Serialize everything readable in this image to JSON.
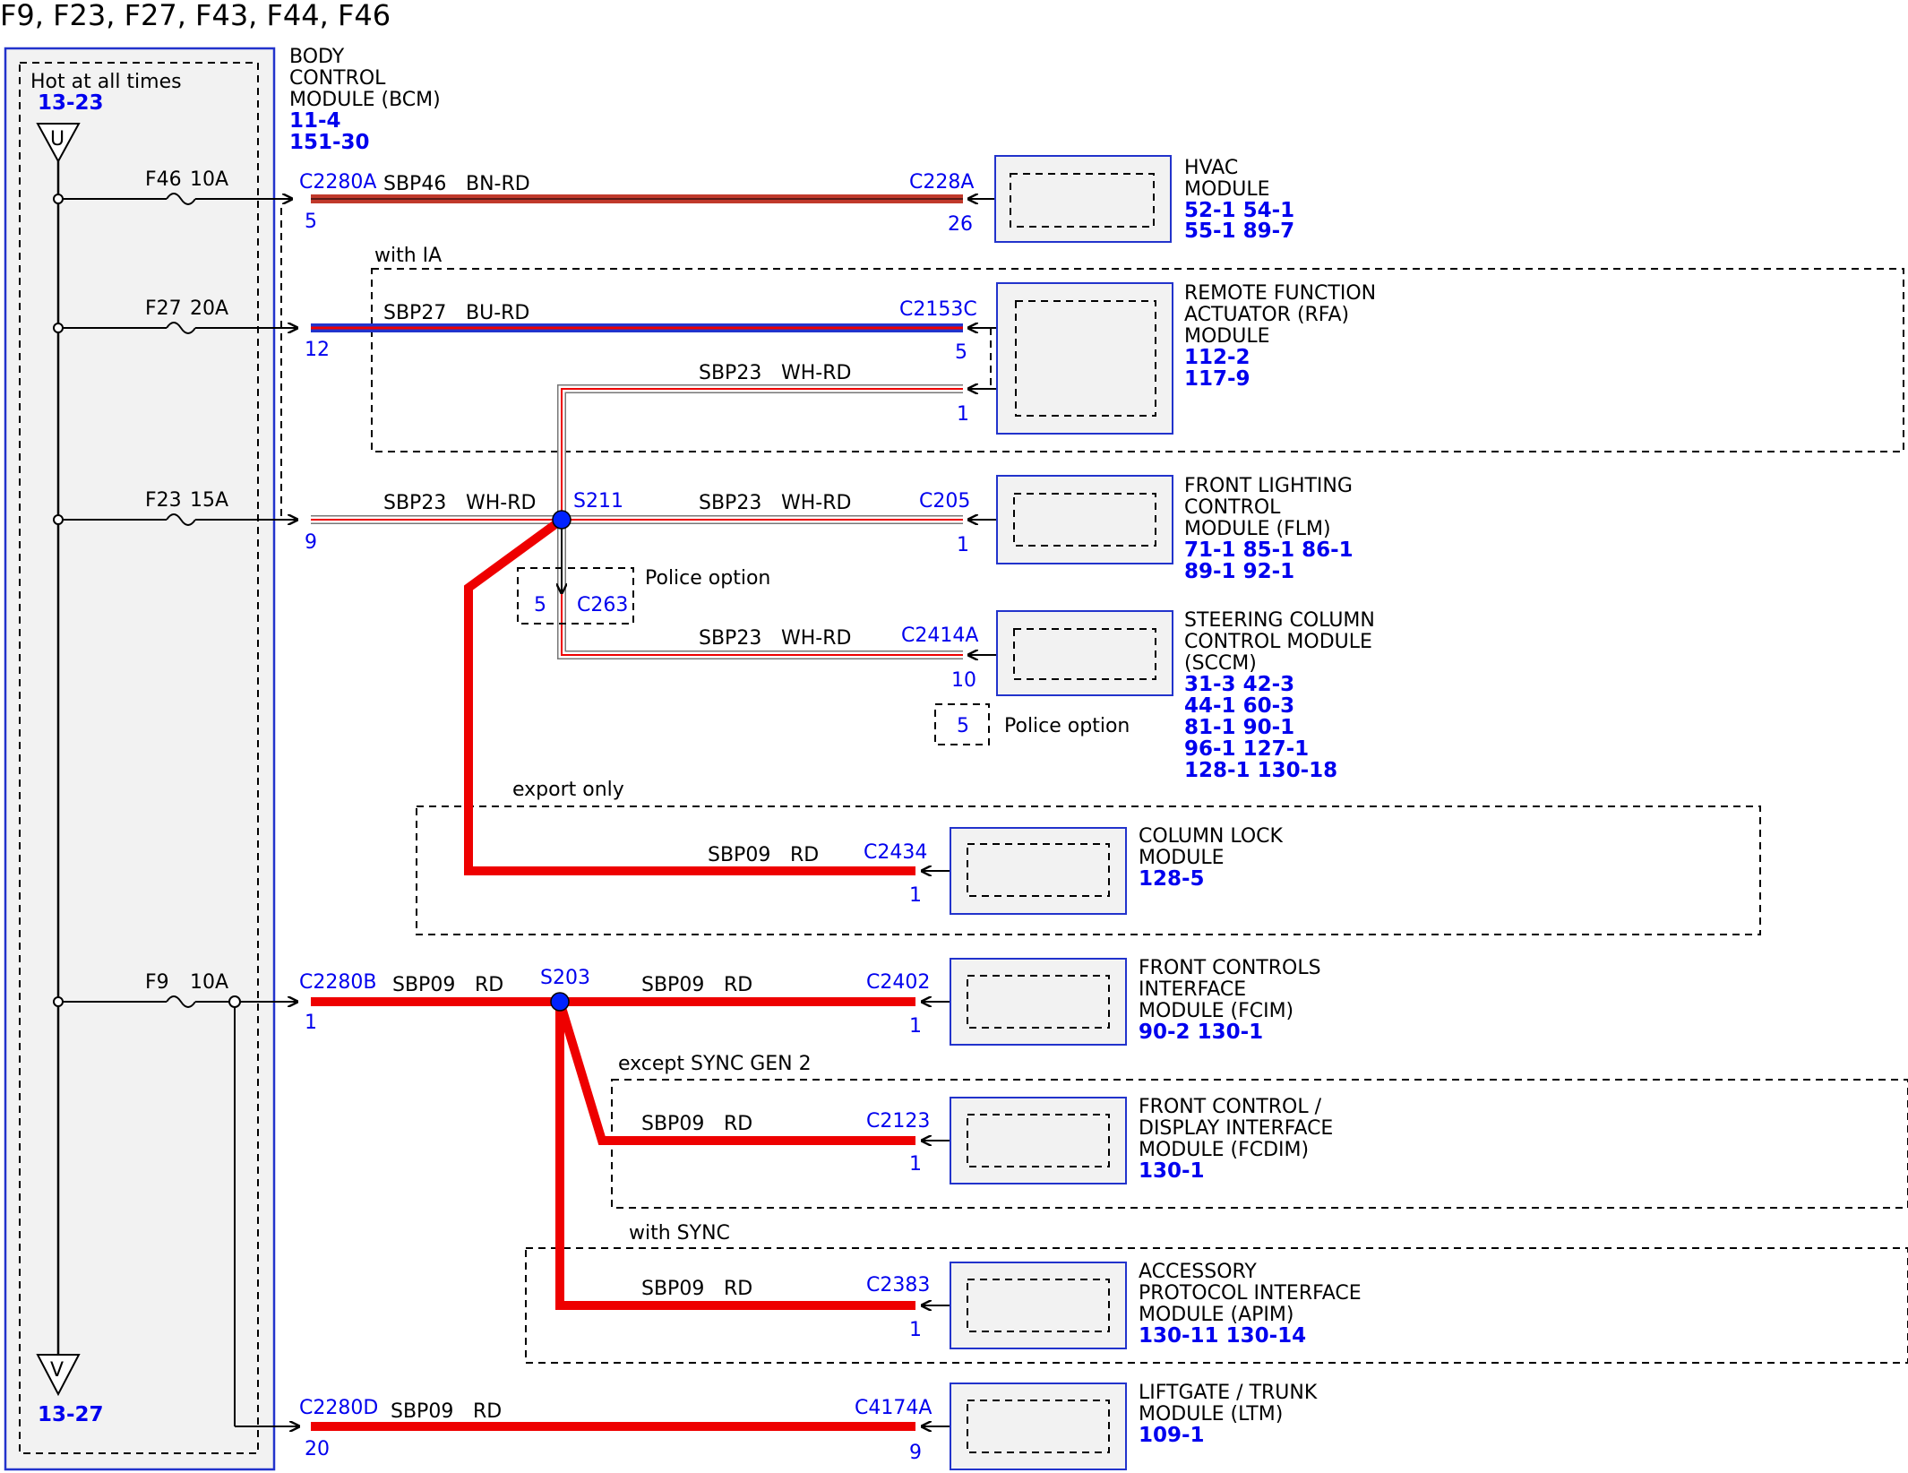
{
  "title": "F9, F23, F27, F43, F44, F46",
  "bcm": {
    "hot_label": "Hot at all times",
    "hot_ref": "13-23",
    "name_lines": [
      "BODY",
      "CONTROL",
      "MODULE (BCM)"
    ],
    "refs": [
      "11-4",
      "151-30"
    ],
    "bus_top_symbol": "U",
    "bus_bottom_symbol": "V",
    "bus_bottom_ref": "13-27"
  },
  "fuses": {
    "f46": {
      "name": "F46",
      "rating": "10A"
    },
    "f27": {
      "name": "F27",
      "rating": "20A"
    },
    "f23": {
      "name": "F23",
      "rating": "15A"
    },
    "f9": {
      "name": "F9",
      "rating": "10A"
    }
  },
  "wires": {
    "hvac": {
      "bcm_connector": "C2280A",
      "bcm_pin": "5",
      "circuit": "SBP46",
      "color": "BN-RD",
      "module_connector": "C228A",
      "module_pin": "26"
    },
    "rfa": {
      "bcm_pin": "12",
      "circuit": "SBP27",
      "color": "BU-RD",
      "module_connector": "C2153C",
      "module_pin": "5"
    },
    "rfa2": {
      "circuit": "SBP23",
      "color": "WH-RD",
      "module_pin": "1"
    },
    "flm_in": {
      "bcm_pin": "9",
      "circuit": "SBP23",
      "color": "WH-RD",
      "splice": "S211"
    },
    "flm": {
      "circuit": "SBP23",
      "color": "WH-RD",
      "module_connector": "C205",
      "module_pin": "1"
    },
    "c263": {
      "pin": "5",
      "connector": "C263",
      "note": "Police option"
    },
    "sccm": {
      "circuit": "SBP23",
      "color": "WH-RD",
      "module_connector": "C2414A",
      "module_pin": "10"
    },
    "sccm_opt": {
      "pin": "5",
      "note": "Police option"
    },
    "lock": {
      "circuit": "SBP09",
      "color": "RD",
      "module_connector": "C2434",
      "module_pin": "1"
    },
    "fcim_in": {
      "bcm_connector": "C2280B",
      "bcm_pin": "1",
      "circuit": "SBP09",
      "color": "RD",
      "splice": "S203"
    },
    "fcim": {
      "circuit": "SBP09",
      "color": "RD",
      "module_connector": "C2402",
      "module_pin": "1"
    },
    "fcdim": {
      "circuit": "SBP09",
      "color": "RD",
      "module_connector": "C2123",
      "module_pin": "1"
    },
    "apim": {
      "circuit": "SBP09",
      "color": "RD",
      "module_connector": "C2383",
      "module_pin": "1"
    },
    "ltm": {
      "bcm_connector": "C2280D",
      "bcm_pin": "20",
      "circuit": "SBP09",
      "color": "RD",
      "module_connector": "C4174A",
      "module_pin": "9"
    }
  },
  "options": {
    "ia": "with IA",
    "export": "export only",
    "sync_gen2": "except SYNC GEN 2",
    "sync": "with SYNC"
  },
  "modules": {
    "hvac": {
      "lines": [
        "HVAC",
        "MODULE"
      ],
      "refs": [
        "52-1  54-1",
        "55-1  89-7"
      ]
    },
    "rfa": {
      "lines": [
        "REMOTE FUNCTION",
        "ACTUATOR (RFA)",
        "MODULE"
      ],
      "refs": [
        "112-2",
        "117-9"
      ]
    },
    "flm": {
      "lines": [
        "FRONT LIGHTING",
        "CONTROL",
        "MODULE (FLM)"
      ],
      "refs": [
        "71-1    85-1    86-1",
        "89-1    92-1"
      ]
    },
    "sccm": {
      "lines": [
        "STEERING COLUMN",
        "CONTROL MODULE",
        "(SCCM)"
      ],
      "refs": [
        "31-3     42-3",
        "44-1     60-3",
        "81-1     90-1",
        "96-1     127-1",
        "128-1   130-18"
      ]
    },
    "lock": {
      "lines": [
        "COLUMN LOCK",
        "MODULE"
      ],
      "refs": [
        "128-5"
      ]
    },
    "fcim": {
      "lines": [
        "FRONT CONTROLS",
        "INTERFACE",
        "MODULE (FCIM)"
      ],
      "refs": [
        "90-2     130-1"
      ]
    },
    "fcdim": {
      "lines": [
        "FRONT CONTROL /",
        "DISPLAY INTERFACE",
        "MODULE (FCDIM)"
      ],
      "refs": [
        "130-1"
      ]
    },
    "apim": {
      "lines": [
        "ACCESSORY",
        "PROTOCOL INTERFACE",
        "MODULE (APIM)"
      ],
      "refs": [
        "130-11    130-14"
      ]
    },
    "ltm": {
      "lines": [
        "LIFTGATE / TRUNK",
        "MODULE (LTM)"
      ],
      "refs": [
        "109-1"
      ]
    }
  },
  "colors": {
    "wire_red": "#ee0000",
    "wire_brown": "#c0392b",
    "wire_blue": "#2233cc",
    "label_blue": "#0000ee",
    "module_fill": "#f2f2f2",
    "splice": "#0022ff"
  }
}
